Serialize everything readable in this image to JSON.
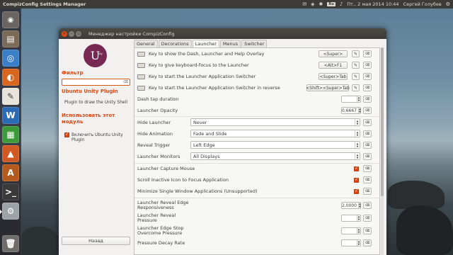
{
  "top_panel": {
    "app_title": "CompizConfig Settings Manager",
    "keyboard_layout": "Ru",
    "clock": "Пт., 2 мая 2014 10:44",
    "user": "Сергей Голубев"
  },
  "launcher_icons": [
    "dash-icon",
    "files-icon",
    "chromium-icon",
    "firefox-icon",
    "text-editor-icon",
    "libreoffice-writer-icon",
    "libreoffice-calc-icon",
    "libreoffice-impress-icon",
    "ubuntu-software-icon",
    "terminal-icon",
    "ccsm-icon",
    "trash-icon"
  ],
  "window": {
    "title": "Менеджер настройки CompizConfig"
  },
  "left_pane": {
    "logo_letter": "U",
    "logo_caption": "nity",
    "filter_heading": "Фильтр",
    "filter_value": "",
    "plugin_title": "Ubuntu Unity Plugin",
    "plugin_description": "Plugin to draw the Unity Shell",
    "use_heading": "Использовать этот модуль",
    "enable_label": "Включить Ubuntu Unity Plugin",
    "enable_checked": true,
    "back_button": "Назад"
  },
  "tabs": [
    {
      "label": "General",
      "active": false
    },
    {
      "label": "Decorations",
      "active": false
    },
    {
      "label": "Launcher",
      "active": true
    },
    {
      "label": "Menus",
      "active": false
    },
    {
      "label": "Switcher",
      "active": false
    }
  ],
  "key_settings": [
    {
      "label": "Key to show the Dash, Launcher and Help Overlay",
      "value": "<Super>"
    },
    {
      "label": "Key to give keyboard-focus to the Launcher",
      "value": "<Alt>F1"
    },
    {
      "label": "Key to start the Launcher Application Switcher",
      "value": "<Super>Tab"
    },
    {
      "label": "Key to start the Launcher Application Switcher in reverse",
      "value": "<Shift><Super>Tab"
    }
  ],
  "spin_settings": [
    {
      "label": "Dash tap duration",
      "value": ""
    },
    {
      "label": "Launcher Opacity",
      "value": "0,6667"
    }
  ],
  "combo_settings": [
    {
      "label": "Hide Launcher",
      "value": "Never"
    },
    {
      "label": "Hide Animation",
      "value": "Fade and Slide"
    },
    {
      "label": "Reveal Trigger",
      "value": "Left Edge"
    },
    {
      "label": "Launcher Monitors",
      "value": "All Displays"
    }
  ],
  "check_settings": [
    {
      "label": "Launcher Capture Mouse",
      "checked": true
    },
    {
      "label": "Scroll Inactive Icon to Focus Application",
      "checked": true
    },
    {
      "label": "Minimize Single Window Applications (Unsupported)",
      "checked": true
    }
  ],
  "bottom_spin_settings": [
    {
      "label": "Launcher Reveal Edge Responsiveness",
      "value": "2,0000"
    },
    {
      "label": "Launcher Reveal Pressure",
      "value": ""
    },
    {
      "label": "Launcher Edge Stop Overcome Pressure",
      "value": ""
    },
    {
      "label": "Pressure Decay Rate",
      "value": ""
    }
  ],
  "edit_glyph": "✎",
  "reset_glyph": "⌫"
}
